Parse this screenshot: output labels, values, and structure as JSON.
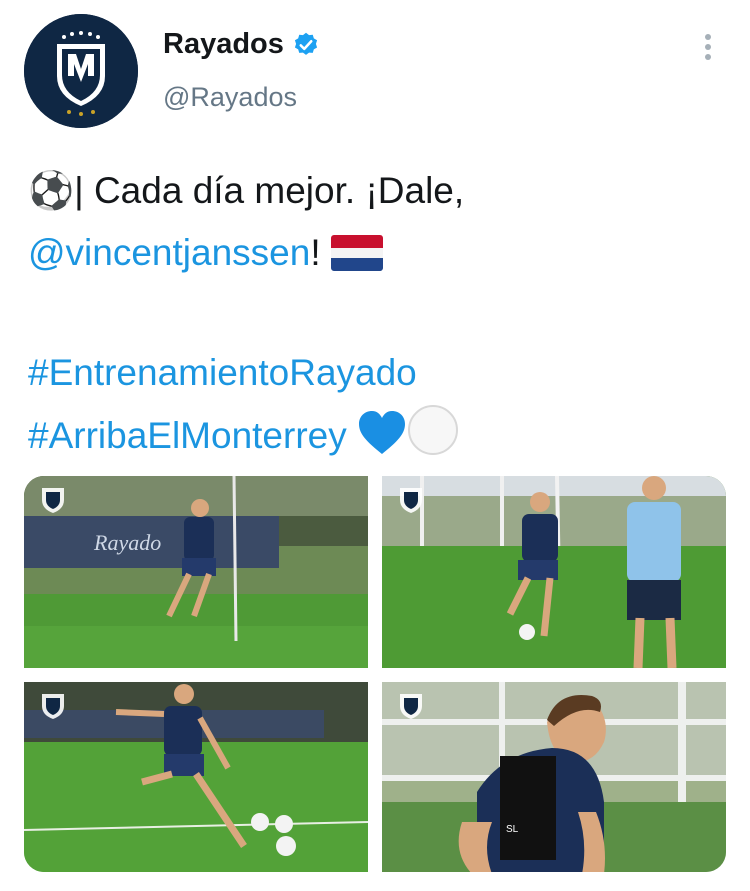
{
  "account": {
    "name": "Rayados",
    "handle": "@Rayados",
    "verified_color": "#1da1f2"
  },
  "tweet": {
    "line1": "⚽| Cada día mejor. ¡Dale,",
    "mention": "@vincentjanssen",
    "mention_suffix": "!",
    "hashtag1": "#EntrenamientoRayado",
    "hashtag2": "#ArribaElMonterrey"
  },
  "colors": {
    "link": "#1b95e0",
    "text": "#14171a",
    "muted": "#657786",
    "grass": "#3f8f2e",
    "kit": "#1b2f57"
  },
  "icons": {
    "verified": "verified-badge-icon",
    "more": "more-vertical-icon",
    "flag": "netherlands-flag-icon",
    "heart": "blue-heart-icon",
    "circle": "white-circle-icon"
  },
  "media": {
    "count": 4
  }
}
